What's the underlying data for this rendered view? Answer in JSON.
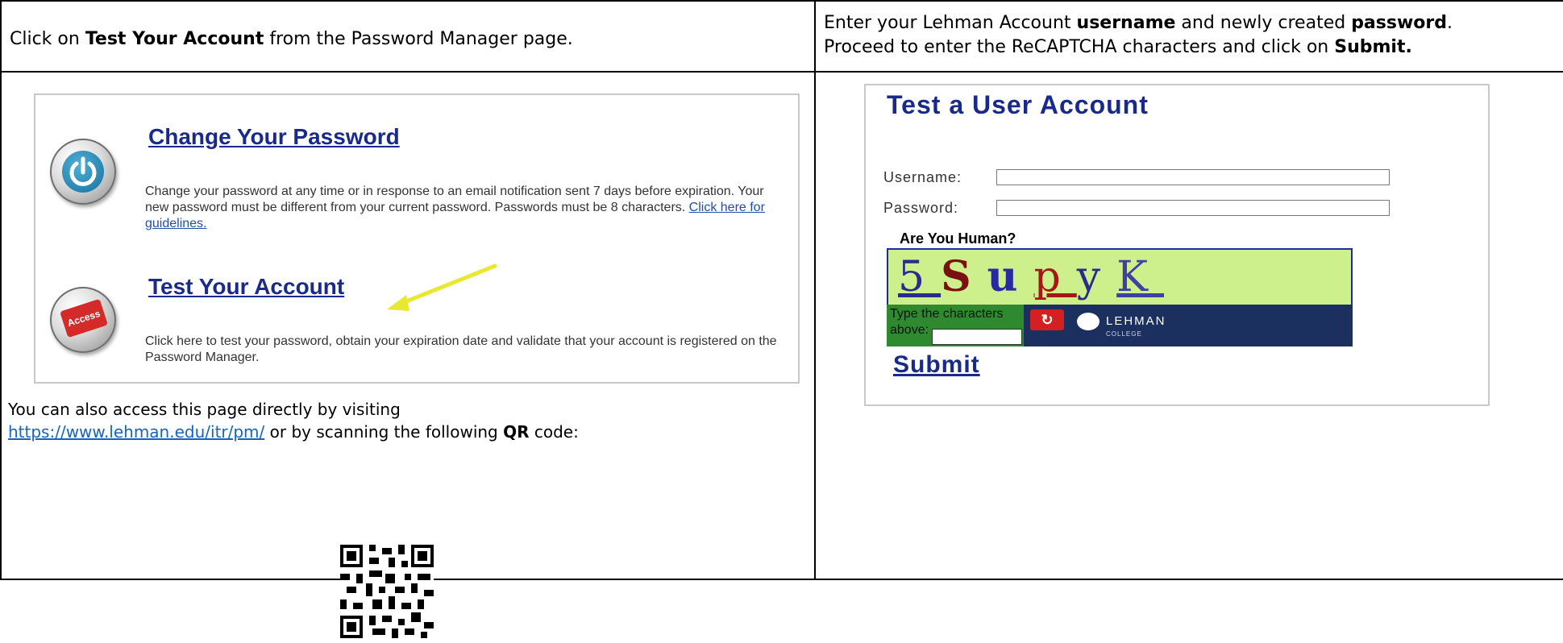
{
  "left_column": {
    "instruction": {
      "prefix": "Click on ",
      "bold": "Test Your Account",
      "suffix": " from the Password Manager page."
    },
    "screenshot": {
      "change_password": {
        "title": "Change Your Password",
        "body": "Change your password at any time or in response to an email notification sent 7 days before expiration. Your new password must be different from your current password. Passwords must be 8 characters. ",
        "link": "Click here for guidelines.",
        "icon": "power-icon"
      },
      "test_account": {
        "title": "Test Your Account",
        "icon_label": "Access",
        "body": "Click here to test your password, obtain your expiration date and validate that your account is registered on the Password Manager.",
        "icon": "access-icon"
      },
      "arrow_color": "#e8e832"
    },
    "access_note": {
      "line1": "You can also access this page directly by visiting",
      "url": "https://www.lehman.edu/itr/pm/",
      "after_url": " or by scanning the following ",
      "bold": "QR",
      "end": " code:"
    },
    "qr_icon": "qr-code-icon"
  },
  "right_column": {
    "instruction": {
      "p1": "Enter your Lehman Account ",
      "b1": "username",
      "p2": " and newly created ",
      "b2": "password",
      "p3": ".",
      "p4": "Proceed to enter the ReCAPTCHA characters and click on ",
      "b3": "Submit."
    },
    "screenshot": {
      "title": "Test a User Account",
      "username_label": "Username:",
      "password_label": "Password:",
      "human_label": "Are You Human?",
      "captcha_chars": [
        "5",
        "S",
        "u",
        "p",
        "y",
        "K"
      ],
      "captcha_prompt_line1": "Type the characters",
      "captcha_prompt_line2": "above:",
      "refresh_icon": "refresh-icon",
      "logo_text": "LEHMAN",
      "logo_sub": "COLLEGE",
      "submit_label": "Submit"
    }
  },
  "colors": {
    "link_blue": "#1565c0",
    "title_navy": "#1a2a8a",
    "captcha_bg": "#cdf08c"
  }
}
